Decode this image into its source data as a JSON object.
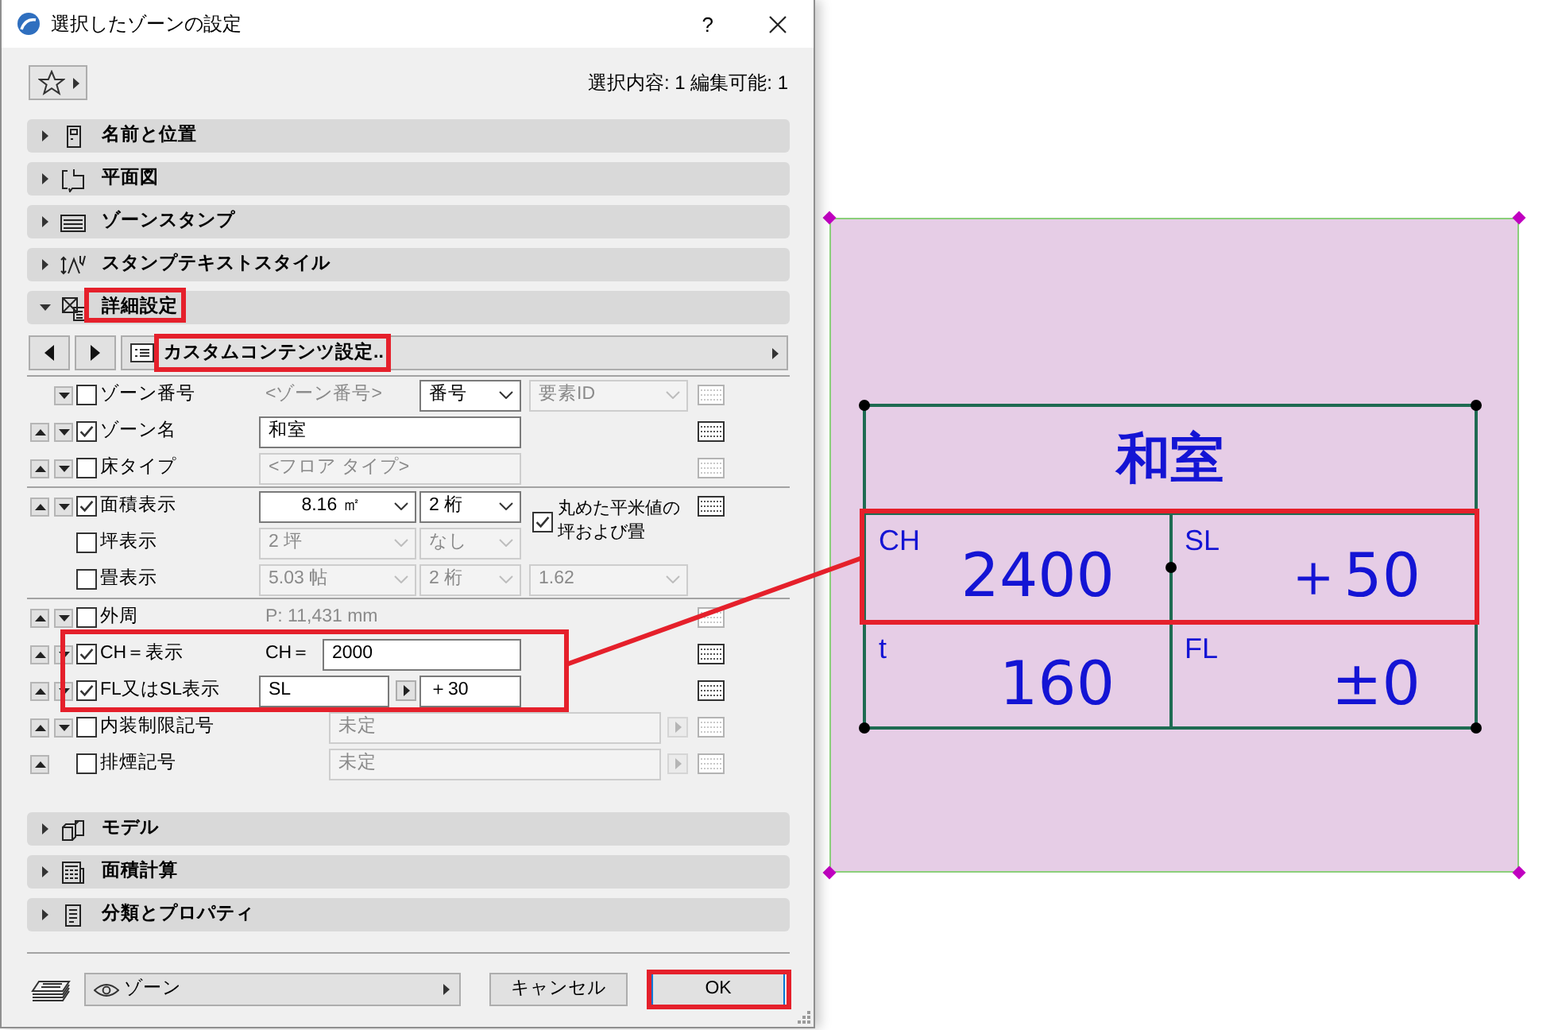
{
  "window": {
    "title": "選択したゾーンの設定",
    "help": "?"
  },
  "toolbar": {
    "selection_info": "選択内容: 1 編集可能: 1"
  },
  "sections": [
    {
      "label": "名前と位置",
      "expanded": false,
      "highlighted": false
    },
    {
      "label": "平面図",
      "expanded": false,
      "highlighted": false
    },
    {
      "label": "ゾーンスタンプ",
      "expanded": false,
      "highlighted": false
    },
    {
      "label": "スタンプテキストスタイル",
      "expanded": false,
      "highlighted": false
    },
    {
      "label": "詳細設定",
      "expanded": true,
      "highlighted": true,
      "details": {
        "content_set": {
          "label": "カスタムコンテンツ設定..",
          "highlighted": true
        },
        "groups": [
          {
            "rows": [
              {
                "kind": "number",
                "label": "ゾーン番号",
                "move_up": false,
                "move_down": true,
                "checked": false,
                "highlighted": false,
                "controls": [
                  {
                    "kind": "text",
                    "value": "<ゾーン番号>",
                    "disabled": true
                  },
                  {
                    "kind": "select",
                    "value": "番号",
                    "disabled": false
                  },
                  {
                    "kind": "select",
                    "value": "要素ID",
                    "disabled": true
                  }
                ],
                "style_button": {
                  "disabled": true
                }
              },
              {
                "kind": "text",
                "label": "ゾーン名",
                "move_up": true,
                "move_down": true,
                "checked": true,
                "highlighted": false,
                "controls": [
                  {
                    "kind": "input",
                    "value": "和室",
                    "disabled": false
                  }
                ],
                "style_button": {
                  "disabled": false
                }
              },
              {
                "kind": "text",
                "label": "床タイプ",
                "move_up": true,
                "move_down": true,
                "checked": false,
                "highlighted": false,
                "controls": [
                  {
                    "kind": "input",
                    "value": "<フロア タイプ>",
                    "disabled": true
                  }
                ],
                "style_button": {
                  "disabled": true
                }
              }
            ]
          },
          {
            "rows": [
              {
                "kind": "area",
                "label": "面積表示",
                "move_up": true,
                "move_down": true,
                "checked": true,
                "highlighted": false,
                "controls": [
                  {
                    "kind": "select",
                    "value": "8.16 ㎡",
                    "disabled": false
                  },
                  {
                    "kind": "select",
                    "value": "2 桁",
                    "disabled": false
                  },
                  {
                    "kind": "check",
                    "label": "丸めた平米値の坪および畳",
                    "checked": true
                  }
                ],
                "style_button": {
                  "disabled": false
                }
              },
              {
                "kind": "unit",
                "label": "坪表示",
                "move_up": false,
                "move_down": false,
                "checked": false,
                "highlighted": false,
                "controls": [
                  {
                    "kind": "select",
                    "value": "2 坪",
                    "disabled": true
                  },
                  {
                    "kind": "select",
                    "value": "なし",
                    "disabled": true
                  }
                ]
              },
              {
                "kind": "unit",
                "label": "畳表示",
                "move_up": false,
                "move_down": false,
                "checked": false,
                "highlighted": false,
                "controls": [
                  {
                    "kind": "select",
                    "value": "5.03 帖",
                    "disabled": true
                  },
                  {
                    "kind": "select",
                    "value": "2 桁",
                    "disabled": true
                  },
                  {
                    "kind": "select",
                    "value": "1.62",
                    "disabled": true
                  }
                ]
              }
            ]
          },
          {
            "rows": [
              {
                "kind": "reading",
                "label": "外周",
                "move_up": true,
                "move_down": true,
                "checked": false,
                "highlighted": false,
                "controls": [
                  {
                    "kind": "text",
                    "value": "P: 11,431 mm",
                    "disabled": true
                  }
                ],
                "style_button": {
                  "disabled": true
                }
              },
              {
                "kind": "prefix",
                "label": "CH＝表示",
                "move_up": true,
                "move_down": true,
                "checked": true,
                "highlighted": true,
                "controls": [
                  {
                    "kind": "text",
                    "value": "CH＝",
                    "disabled": false
                  },
                  {
                    "kind": "input",
                    "value": "2000",
                    "disabled": false
                  }
                ],
                "style_button": {
                  "disabled": false
                }
              },
              {
                "kind": "pair",
                "label": "FL又はSL表示",
                "move_up": true,
                "move_down": true,
                "checked": true,
                "highlighted": true,
                "controls": [
                  {
                    "kind": "input",
                    "value": "SL",
                    "disabled": false
                  },
                  {
                    "kind": "arrow",
                    "disabled": false
                  },
                  {
                    "kind": "input",
                    "value": "＋30",
                    "disabled": false
                  }
                ],
                "style_button": {
                  "disabled": false
                }
              },
              {
                "kind": "symbol",
                "label": "内装制限記号",
                "move_up": true,
                "move_down": true,
                "checked": false,
                "highlighted": false,
                "controls": [
                  {
                    "kind": "input",
                    "value": "未定",
                    "disabled": true
                  },
                  {
                    "kind": "arrow",
                    "disabled": true
                  }
                ],
                "style_button": {
                  "disabled": true
                }
              },
              {
                "kind": "symbol",
                "label": "排煙記号",
                "move_up": true,
                "move_down": false,
                "checked": false,
                "highlighted": false,
                "controls": [
                  {
                    "kind": "input",
                    "value": "未定",
                    "disabled": true
                  },
                  {
                    "kind": "arrow",
                    "disabled": true
                  }
                ],
                "style_button": {
                  "disabled": true
                }
              }
            ]
          }
        ]
      }
    },
    {
      "label": "モデル",
      "expanded": false,
      "highlighted": false
    },
    {
      "label": "面積計算",
      "expanded": false,
      "highlighted": false
    },
    {
      "label": "分類とプロパティ",
      "expanded": false,
      "highlighted": false
    }
  ],
  "footer": {
    "layer": "ゾーン",
    "buttons": [
      {
        "label": "キャンセル",
        "default": false,
        "highlighted": false
      },
      {
        "label": "OK",
        "default": true,
        "highlighted": true
      }
    ]
  },
  "canvas": {
    "stamp": {
      "title": "和室",
      "rows": [
        {
          "highlighted": true,
          "cells": [
            {
              "label": "CH",
              "value": "2400"
            },
            {
              "label": "SL",
              "value": "＋50"
            }
          ]
        },
        {
          "highlighted": false,
          "cells": [
            {
              "label": "t",
              "value": "160"
            },
            {
              "label": "FL",
              "value": "±0"
            }
          ]
        }
      ]
    }
  }
}
